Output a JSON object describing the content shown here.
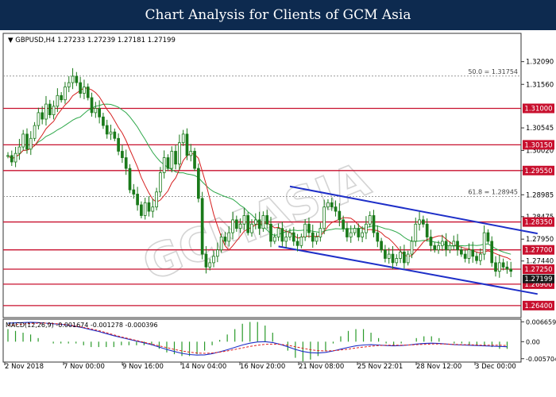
{
  "banner": {
    "title": "Chart Analysis for Clients of GCM Asia"
  },
  "watermark": "GCMASIA",
  "chart_data": {
    "type": "candlestick",
    "title": "GCMASIA",
    "symbol_info": "GBPUSD,H4  1.27233 1.27239 1.27181 1.27199",
    "price_ticks": [
      "1.32090",
      "1.31560",
      "1.30545",
      "1.30020",
      "1.29550",
      "1.28985",
      "1.28475",
      "1.27950",
      "1.27440"
    ],
    "ylim": [
      1.2612,
      1.3275
    ],
    "x_ticks": [
      "2 Nov 2018",
      "7 Nov 00:00",
      "9 Nov 16:00",
      "14 Nov 04:00",
      "16 Nov 20:00",
      "21 Nov 08:00",
      "25 Nov 22:01",
      "28 Nov 12:00",
      "3 Dec 00:00"
    ],
    "levels": [
      {
        "value": 1.31,
        "label": "1.31000"
      },
      {
        "value": 1.3015,
        "label": "1.30150"
      },
      {
        "value": 1.2955,
        "label": "1.29550"
      },
      {
        "value": 1.2835,
        "label": "1.28350"
      },
      {
        "value": 1.277,
        "label": "1.27700"
      },
      {
        "value": 1.2725,
        "label": "1.27250"
      },
      {
        "value": 1.269,
        "label": "1.26900"
      },
      {
        "value": 1.264,
        "label": "1.26400"
      }
    ],
    "fibo": [
      {
        "value": 1.31754,
        "label": "50.0 = 1.31754"
      },
      {
        "value": 1.28945,
        "label": "61.8 = 1.28945"
      }
    ],
    "channel": [
      {
        "from": {
          "bar": 74,
          "price": 1.2918
        },
        "to": {
          "bar": 139,
          "price": 1.2808
        }
      },
      {
        "from": {
          "bar": 71,
          "price": 1.2778
        },
        "to": {
          "bar": 139,
          "price": 1.2667
        }
      }
    ],
    "current_price": "1.27199",
    "closes": [
      1.299,
      1.2975,
      1.2995,
      1.301,
      1.304,
      1.3005,
      1.303,
      1.306,
      1.309,
      1.3075,
      1.311,
      1.3085,
      1.3105,
      1.313,
      1.312,
      1.315,
      1.316,
      1.3175,
      1.316,
      1.3135,
      1.315,
      1.3125,
      1.309,
      1.31,
      1.308,
      1.306,
      1.304,
      1.3045,
      1.303,
      1.3,
      1.2985,
      1.296,
      1.291,
      1.29,
      1.2875,
      1.285,
      1.288,
      1.286,
      1.287,
      1.2905,
      1.295,
      1.2985,
      1.296,
      1.3,
      1.297,
      1.302,
      1.304,
      1.299,
      1.3,
      1.296,
      1.289,
      1.276,
      1.273,
      1.274,
      1.2755,
      1.277,
      1.28,
      1.279,
      1.281,
      1.284,
      1.282,
      1.283,
      1.285,
      1.281,
      1.283,
      1.284,
      1.282,
      1.285,
      1.283,
      1.279,
      1.28,
      1.282,
      1.279,
      1.28,
      1.281,
      1.279,
      1.278,
      1.28,
      1.283,
      1.281,
      1.279,
      1.28,
      1.282,
      1.287,
      1.288,
      1.287,
      1.286,
      1.284,
      1.282,
      1.28,
      1.281,
      1.282,
      1.28,
      1.281,
      1.283,
      1.285,
      1.281,
      1.279,
      1.277,
      1.275,
      1.276,
      1.274,
      1.275,
      1.2765,
      1.274,
      1.276,
      1.279,
      1.283,
      1.284,
      1.283,
      1.28,
      1.278,
      1.277,
      1.278,
      1.279,
      1.277,
      1.278,
      1.279,
      1.277,
      1.276,
      1.275,
      1.277,
      1.2755,
      1.2745,
      1.276,
      1.281,
      1.279,
      1.274,
      1.272,
      1.274,
      1.273,
      1.2725,
      1.272
    ]
  },
  "macd": {
    "label": "MACD(12,26,9) -0.001674 -0.001278 -0.000396",
    "ticks": [
      "0.006659",
      "0.00",
      "-0.005704"
    ],
    "ylim": [
      -0.0063,
      0.007
    ],
    "main": [
      0.0062,
      0.0063,
      0.0064,
      0.0065,
      0.0064,
      0.0062,
      0.006,
      0.0058,
      0.0055,
      0.0051,
      0.0046,
      0.004,
      0.0034,
      0.0027,
      0.002,
      0.0014,
      0.0008,
      0.0002,
      -0.0004,
      -0.001,
      -0.0018,
      -0.0026,
      -0.0033,
      -0.0039,
      -0.0043,
      -0.0045,
      -0.0044,
      -0.004,
      -0.0034,
      -0.0027,
      -0.0019,
      -0.0011,
      -0.0005,
      -0.0001,
      0.0,
      -0.0003,
      -0.0009,
      -0.0017,
      -0.0026,
      -0.0033,
      -0.0037,
      -0.0038,
      -0.0036,
      -0.0031,
      -0.0025,
      -0.0019,
      -0.0014,
      -0.0011,
      -0.001,
      -0.0011,
      -0.0013,
      -0.0014,
      -0.0013,
      -0.0011,
      -0.0008,
      -0.0006,
      -0.0005,
      -0.0006,
      -0.0008,
      -0.001,
      -0.0011,
      -0.0012,
      -0.0013,
      -0.0014,
      -0.0015,
      -0.0016,
      -0.0017
    ],
    "signal": [
      0.0055,
      0.0057,
      0.0059,
      0.0061,
      0.0062,
      0.0062,
      0.0061,
      0.0059,
      0.0056,
      0.0052,
      0.0048,
      0.0043,
      0.0037,
      0.003,
      0.0023,
      0.0016,
      0.001,
      0.0004,
      -0.0002,
      -0.0008,
      -0.0014,
      -0.002,
      -0.0026,
      -0.0031,
      -0.0035,
      -0.0038,
      -0.0039,
      -0.0038,
      -0.0035,
      -0.0031,
      -0.0026,
      -0.0021,
      -0.0016,
      -0.0012,
      -0.0009,
      -0.0008,
      -0.0009,
      -0.0012,
      -0.0017,
      -0.0022,
      -0.0027,
      -0.003,
      -0.0031,
      -0.003,
      -0.0028,
      -0.0025,
      -0.0021,
      -0.0018,
      -0.0015,
      -0.0013,
      -0.0012,
      -0.0012,
      -0.0012,
      -0.0011,
      -0.001,
      -0.0009,
      -0.0008,
      -0.0008,
      -0.0008,
      -0.0009,
      -0.001,
      -0.001,
      -0.0011,
      -0.0012,
      -0.0012,
      -0.0012,
      -0.0013
    ]
  },
  "colors": {
    "candle": "#1a7a1a",
    "ma_fast": "#d62020",
    "ma_slow": "#2ea84a",
    "level": "#c8102e",
    "channel": "#1e2fc8",
    "macd_main": "#1e2fc8",
    "macd_signal": "#e02020",
    "price_tag": "#c8102e",
    "current_tag": "#1a1a1a"
  }
}
